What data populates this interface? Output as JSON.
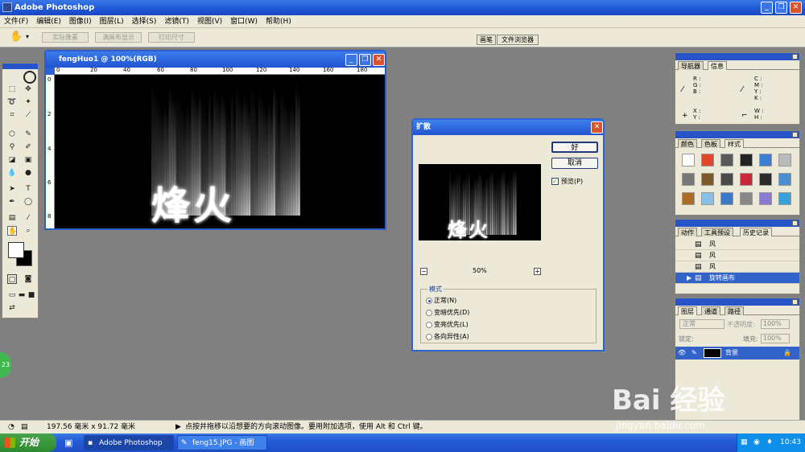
{
  "app": {
    "title": "Adobe Photoshop",
    "minimize": "_",
    "restore": "❐",
    "close": "✕"
  },
  "menu": [
    "文件(F)",
    "编辑(E)",
    "图像(I)",
    "图层(L)",
    "选择(S)",
    "滤镜(T)",
    "视图(V)",
    "窗口(W)",
    "帮助(H)"
  ],
  "options": {
    "actual_pixels": "实际像素",
    "fit_screen": "满画布显示",
    "print_size": "打印尺寸",
    "brushes_tab": "画笔",
    "file_browser_tab": "文件浏览器"
  },
  "document": {
    "title": "fengHuo1 @ 100%(RGB)",
    "ruler_ticks": [
      "0",
      "20",
      "40",
      "60",
      "80",
      "100",
      "120",
      "140",
      "160",
      "180"
    ],
    "left_ruler_ticks": [
      "0",
      "2",
      "4",
      "6",
      "8"
    ],
    "text": "烽火"
  },
  "dialog": {
    "title": "扩散",
    "ok": "好",
    "cancel": "取消",
    "preview_label": "预览(P)",
    "preview_checked": true,
    "zoom": "50%",
    "zoom_out": "−",
    "zoom_in": "+",
    "mode_title": "模式",
    "modes": [
      {
        "label": "正常(N)",
        "selected": true
      },
      {
        "label": "变暗优先(D)",
        "selected": false
      },
      {
        "label": "变亮优先(L)",
        "selected": false
      },
      {
        "label": "各向异性(A)",
        "selected": false
      }
    ]
  },
  "panels": {
    "navigator": {
      "tabs": [
        "导航器",
        "信息"
      ],
      "rgb": [
        "R :",
        "G :",
        "B :"
      ],
      "cmyk": [
        "C :",
        "M :",
        "Y :",
        "K :"
      ],
      "xy": [
        "X :",
        "Y :"
      ],
      "wh": [
        "W :",
        "H :"
      ]
    },
    "styles": {
      "tabs": [
        "颜色",
        "色板",
        "样式"
      ]
    },
    "history": {
      "tabs": [
        "动作",
        "工具预设",
        "历史记录"
      ],
      "items": [
        "风",
        "风",
        "风",
        "旋转画布"
      ]
    },
    "layers": {
      "tabs": [
        "图层",
        "通道",
        "路径"
      ],
      "blend": "正常",
      "opacity_label": "不透明度:",
      "opacity": "100%",
      "lock_label": "锁定:",
      "fill_label": "填充:",
      "fill": "100%",
      "layer_name": "背景"
    }
  },
  "status": {
    "zoom_badge": "23",
    "dims": "197.56 毫米 x 91.72 毫米",
    "hint": "点按并拖移以沿想要的方向滚动图像。要用附加选项，使用 Alt 和 Ctrl 键。"
  },
  "taskbar": {
    "start": "开始",
    "tasks": [
      "Adobe Photoshop",
      "feng15.JPG - 画图"
    ],
    "clock": "10:43"
  },
  "watermark": {
    "brand": "Bai 经验",
    "url": "jingyan.baidu.com"
  }
}
